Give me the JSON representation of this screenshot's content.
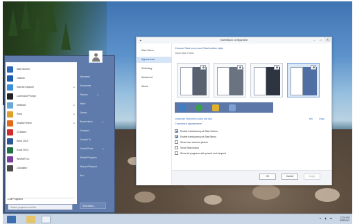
{
  "dialog": {
    "title": "StartIsBack configuration",
    "nav": [
      "Start Menu",
      "Appearance",
      "Switching",
      "Advanced",
      "About"
    ],
    "active_nav": 1,
    "heading": "Choose Start menu and Start button style",
    "style_label": "Visual Style: Plain8",
    "small_note": "Customize Start menu colors and look",
    "links": "Info · Close",
    "section_heading": "Customize appearance",
    "options": [
      {
        "label": "Enable translucency at Start Screen",
        "checked": true
      },
      {
        "label": "Enable translucency at Start Menu",
        "checked": true
      },
      {
        "label": "Show user account picture",
        "checked": false
      },
      {
        "label": "Show Start button",
        "checked": false
      },
      {
        "label": "Show all programs with pinned and frequent",
        "checked": false
      }
    ],
    "buttons": {
      "ok": "OK",
      "cancel": "Cancel",
      "apply": "Apply"
    }
  },
  "startmenu": {
    "pinned": [
      {
        "label": "Start Screen",
        "color": "#2a67b8",
        "arrow": false
      },
      {
        "label": "Outlook",
        "color": "#1e5eb0",
        "arrow": false
      },
      {
        "label": "Internet Explorer",
        "color": "#3b8fd8",
        "arrow": true
      },
      {
        "label": "Command Prompt",
        "color": "#222222",
        "arrow": false
      },
      {
        "label": "Notepad",
        "color": "#6aa6d8",
        "arrow": true
      },
      {
        "label": "Paint",
        "color": "#e0a030",
        "arrow": true
      },
      {
        "label": "Mozilla Firefox",
        "color": "#e06a1c",
        "arrow": true
      },
      {
        "label": "CCleaner",
        "color": "#d22b2b",
        "arrow": false
      },
      {
        "label": "Word 2013",
        "color": "#2b5797",
        "arrow": false
      },
      {
        "label": "Excel 2013",
        "color": "#207245",
        "arrow": false
      },
      {
        "label": "WinRAR 3.x",
        "color": "#7a3f9e",
        "arrow": false
      },
      {
        "label": "Calculator",
        "color": "#4a4a4a",
        "arrow": false
      }
    ],
    "all_programs": "All Programs",
    "search_placeholder": "Search programs and files",
    "right_items": [
      {
        "label": "Username",
        "arrow": false
      },
      {
        "label": "Documents",
        "arrow": false
      },
      {
        "label": "Pictures",
        "arrow": true
      },
      {
        "label": "Music",
        "arrow": false
      },
      {
        "label": "Games",
        "arrow": false
      },
      {
        "label": "Recent items",
        "arrow": true
      },
      {
        "label": "Computer",
        "arrow": false
      },
      {
        "label": "Connect To",
        "arrow": false
      },
      {
        "label": "Control Panel",
        "arrow": true
      },
      {
        "label": "Default Programs",
        "arrow": false
      },
      {
        "label": "Help and Support",
        "arrow": false
      },
      {
        "label": "Run...",
        "arrow": false
      }
    ],
    "shutdown": "Shut down ▸"
  },
  "taskbar": {
    "tray": "▲ ▮ ◀",
    "time": "12:34 PM",
    "date": "6/28/2013"
  },
  "colors": {
    "accent": "#5f7bab",
    "link": "#2f6bc4"
  }
}
